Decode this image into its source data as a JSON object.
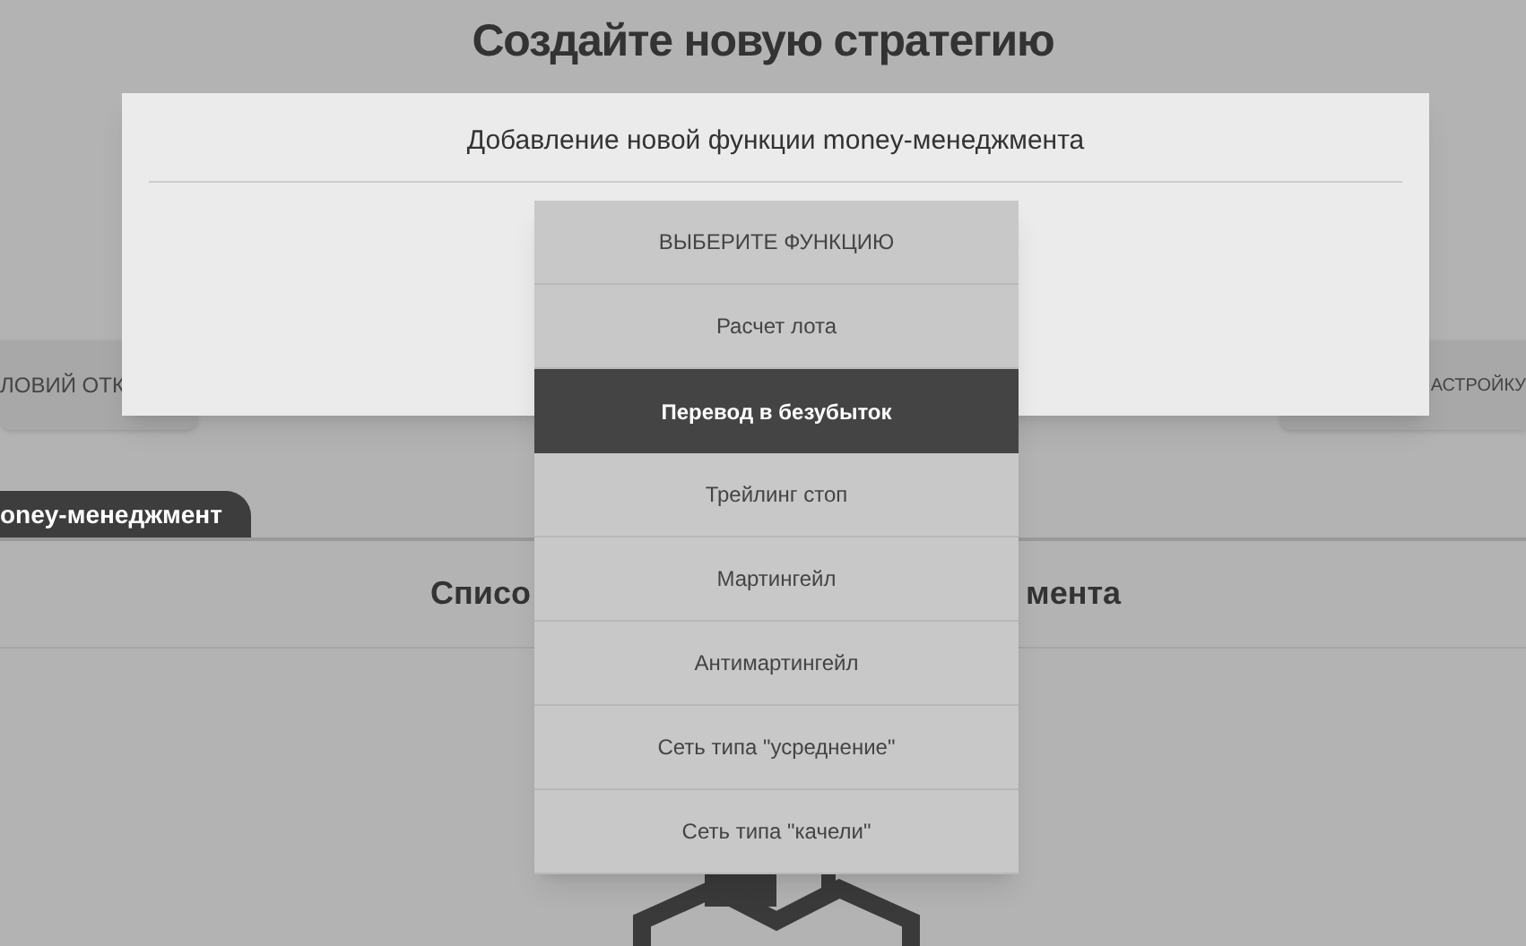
{
  "page_title": "Создайте новую стратегию",
  "toolbar_buttons": [
    {
      "label": "ЛОВИЙ ОТК"
    },
    {
      "label": "АСТРОЙКУ"
    }
  ],
  "tabs": [
    {
      "label": "oney-менеджмент",
      "selected": true
    }
  ],
  "section_heading": {
    "left_part": "Списо",
    "right_part": "мента"
  },
  "dialog": {
    "title": "Добавление новой функции money-менеджмента",
    "options": [
      {
        "label": "ВЫБЕРИТЕ ФУНКЦИЮ",
        "selected": false
      },
      {
        "label": "Расчет лота",
        "selected": false
      },
      {
        "label": "Перевод в безубыток",
        "selected": true
      },
      {
        "label": "Трейлинг стоп",
        "selected": false
      },
      {
        "label": "Мартингейл",
        "selected": false
      },
      {
        "label": "Антимартингейл",
        "selected": false
      },
      {
        "label": "Сеть типа \"усреднение\"",
        "selected": false
      },
      {
        "label": "Сеть типа \"качели\"",
        "selected": false
      }
    ]
  }
}
